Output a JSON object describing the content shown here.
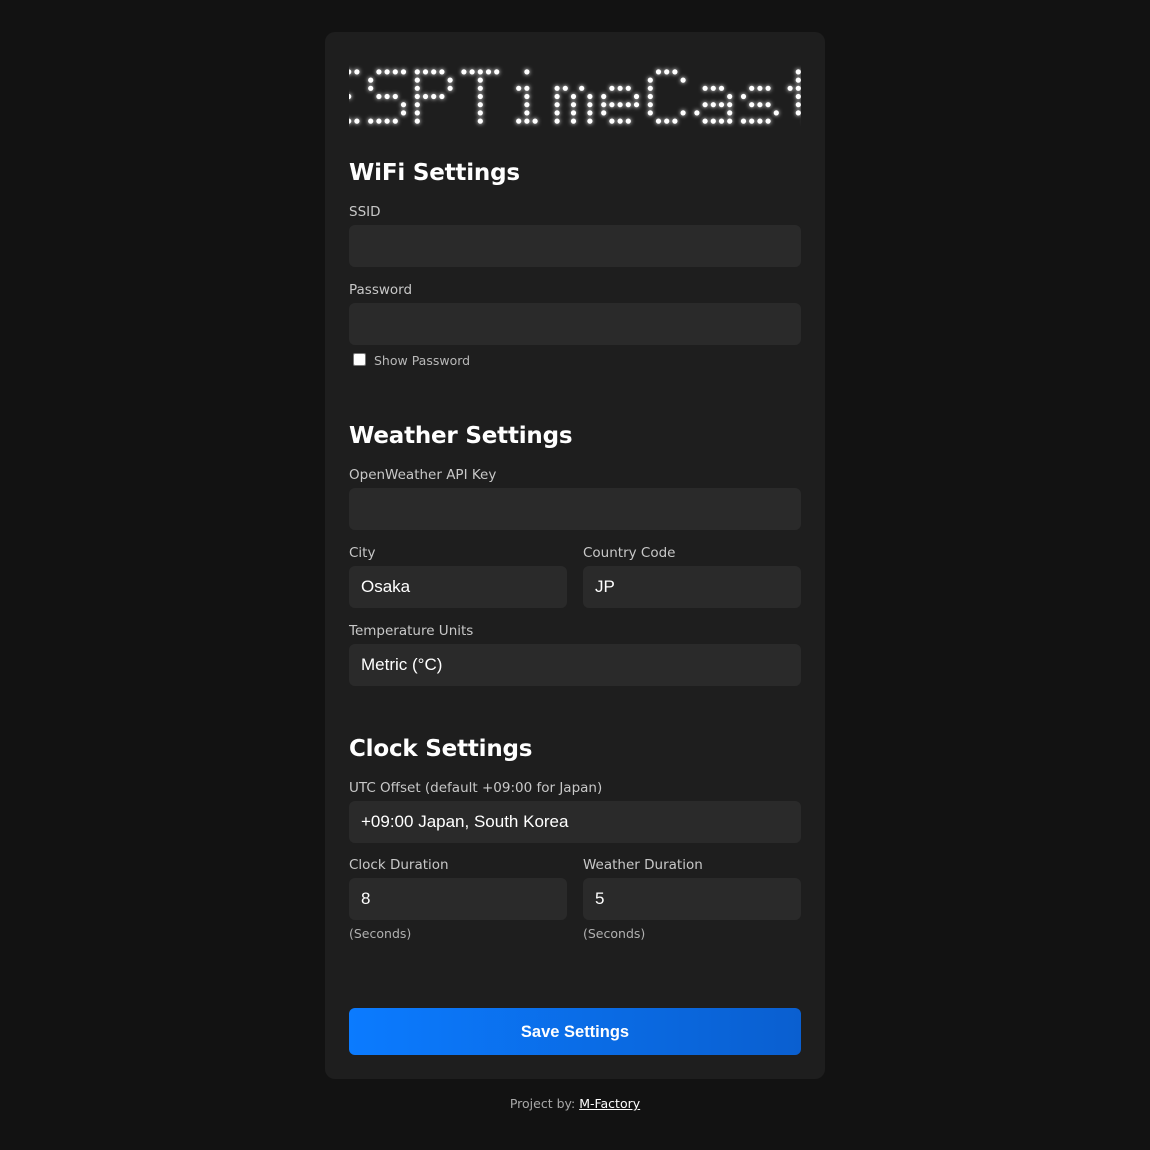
{
  "logo": {
    "text": "ESPTimeCast"
  },
  "wifi": {
    "title": "WiFi Settings",
    "ssid_label": "SSID",
    "ssid_value": "",
    "password_label": "Password",
    "password_value": "",
    "show_password_label": "Show Password",
    "show_password_checked": false
  },
  "weather": {
    "title": "Weather Settings",
    "api_key_label": "OpenWeather API Key",
    "api_key_value": "",
    "city_label": "City",
    "city_value": "Osaka",
    "country_label": "Country Code",
    "country_value": "JP",
    "units_label": "Temperature Units",
    "units_value": "Metric (°C)"
  },
  "clock": {
    "title": "Clock Settings",
    "utc_label": "UTC Offset (default +09:00 for Japan)",
    "utc_value": "+09:00 Japan, South Korea",
    "clock_duration_label": "Clock Duration",
    "clock_duration_value": "8",
    "clock_duration_hint": "(Seconds)",
    "weather_duration_label": "Weather Duration",
    "weather_duration_value": "5",
    "weather_duration_hint": "(Seconds)"
  },
  "save_button": {
    "label": "Save Settings"
  },
  "footer": {
    "prefix": "Project by:",
    "link_text": "M-Factory"
  },
  "colors": {
    "page_background": "#121212",
    "card_background": "#1e1e1e",
    "field_background": "#2a2a2a",
    "accent": "#0b7bff"
  }
}
